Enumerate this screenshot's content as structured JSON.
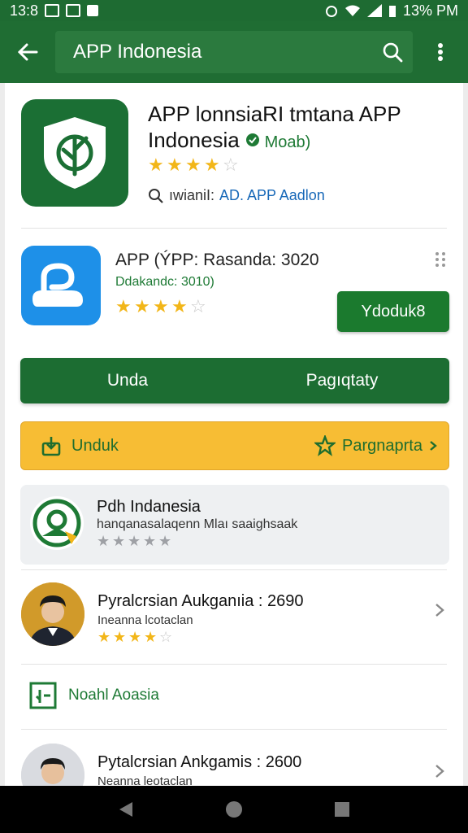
{
  "status_bar": {
    "time": "13:8",
    "battery": "13% PM"
  },
  "app_bar": {
    "search_query": "APP Indonesia"
  },
  "hero_app": {
    "title": "APP lonnsiaRI tmtana APP Indonesia",
    "tag": "Moab)",
    "rating": 4,
    "link_label": "ıwianiI:",
    "link_value": "AD. APP Aadlon"
  },
  "second_app": {
    "title": "APP (ÝPP: Rasanda: 3020",
    "meta": "Ddakandc: 3010)",
    "rating": 4,
    "install_label": "Ydoduk8"
  },
  "green_bar": {
    "left": "Unda",
    "right": "Pagıqtaty"
  },
  "yellow_bar": {
    "left": "Unduk",
    "right": "Pargnaprta"
  },
  "featured": {
    "title": "Pdh Indanesia",
    "subtitle": "hanqanasalaqenn Mlaı saaighsaak",
    "rating": 0
  },
  "list_items": [
    {
      "title": "Pyralcrsian Aukganıia : 2690",
      "subtitle": "Ineanna lcotaclan",
      "rating": 4
    },
    {
      "title": "Pytalcrsian Ankgamis : 2600",
      "subtitle": "Neanna leotaclan"
    }
  ],
  "section_header": {
    "label": "Noahl Aoasia"
  },
  "colors": {
    "brand_green": "#1f6d33",
    "accent_yellow": "#f7bd34",
    "link_blue": "#1768b8",
    "star": "#f2b619"
  }
}
